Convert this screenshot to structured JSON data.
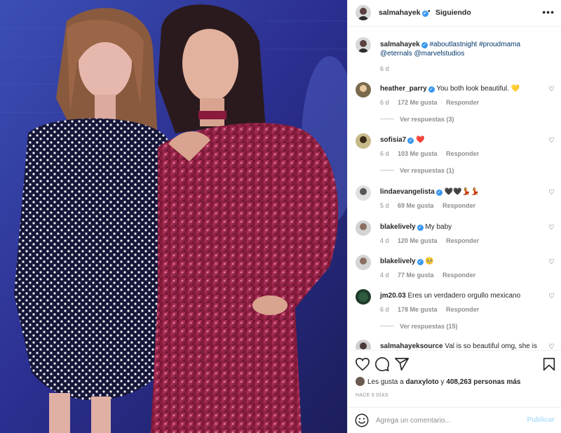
{
  "header": {
    "username": "salmahayek",
    "separator": "•",
    "follow_status": "Siguiendo",
    "more_icon": "more-horizontal-icon"
  },
  "caption": {
    "username": "salmahayek",
    "text": "#aboutlastnight #proudmama @eternals @marvelstudios",
    "age": "6 d"
  },
  "comments": [
    {
      "username": "heather_parry",
      "verified": true,
      "text": "You both look beautiful. 💛",
      "age": "6 d",
      "likes": "172 Me gusta",
      "reply": "Responder",
      "view_replies": "Ver respuestas (3)"
    },
    {
      "username": "sofisia7",
      "verified": true,
      "text": "❤️",
      "age": "6 d",
      "likes": "103 Me gusta",
      "reply": "Responder",
      "view_replies": "Ver respuestas (1)"
    },
    {
      "username": "lindaevangelista",
      "verified": true,
      "text": "🖤🖤💃💃",
      "age": "5 d",
      "likes": "69 Me gusta",
      "reply": "Responder",
      "view_replies": ""
    },
    {
      "username": "blakelively",
      "verified": true,
      "text": "My baby",
      "age": "4 d",
      "likes": "120 Me gusta",
      "reply": "Responder",
      "view_replies": ""
    },
    {
      "username": "blakelively",
      "verified": true,
      "text": "🥺",
      "age": "4 d",
      "likes": "77 Me gusta",
      "reply": "Responder",
      "view_replies": ""
    },
    {
      "username": "jm20.03",
      "verified": false,
      "text": "Eres un verdadero orgullo mexicano",
      "age": "6 d",
      "likes": "178 Me gusta",
      "reply": "Responder",
      "view_replies": "Ver respuestas (15)"
    },
    {
      "username": "salmahayeksource",
      "verified": false,
      "text": "Val is so beautiful omg, she is",
      "age": "",
      "likes": "",
      "reply": "",
      "view_replies": ""
    }
  ],
  "likes": {
    "prefix": "Les gusta a",
    "user": "danxyloto",
    "conj": "y",
    "count": "408,263 personas más"
  },
  "date": "HACE 6 DÍAS",
  "add_comment": {
    "placeholder": "Agrega un comentario...",
    "publish": "Publicar"
  },
  "colors": {
    "verified": "#3897f0",
    "link": "#00376b",
    "muted": "#8e8e8e",
    "publish_disabled": "#b2dffc"
  }
}
